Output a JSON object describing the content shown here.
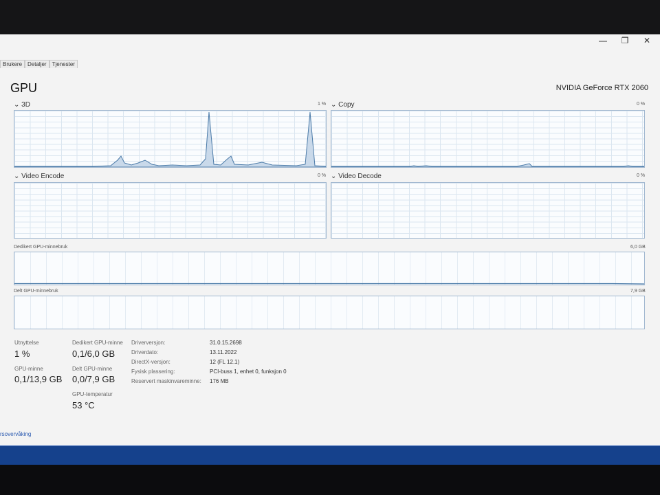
{
  "window": {
    "maximize_glyph": "❐",
    "close_glyph": "✕",
    "minimize_glyph": "—"
  },
  "tabs": [
    "Brukere",
    "Detaljer",
    "Tjenester"
  ],
  "gpu": {
    "title": "GPU",
    "name": "NVIDIA GeForce RTX 2060"
  },
  "engines": [
    {
      "label": "3D",
      "percent": "1 %"
    },
    {
      "label": "Copy",
      "percent": "0 %"
    },
    {
      "label": "Video Encode",
      "percent": "0 %"
    },
    {
      "label": "Video Decode",
      "percent": "0 %"
    }
  ],
  "memory": {
    "dedicated_label": "Dedikert GPU-minnebruk",
    "dedicated_max": "6,0 GB",
    "shared_label": "Delt GPU-minnebruk",
    "shared_max": "7,9 GB"
  },
  "stats": {
    "utilization_label": "Utnyttelse",
    "utilization_value": "1 %",
    "gpu_memory_label": "GPU-minne",
    "gpu_memory_value": "0,1/13,9 GB",
    "dedicated_label": "Dedikert GPU-minne",
    "dedicated_value": "0,1/6,0 GB",
    "shared_label": "Delt GPU-minne",
    "shared_value": "0,0/7,9 GB",
    "temp_label": "GPU-temperatur",
    "temp_value": "53 °C"
  },
  "info": [
    {
      "key": "Driverversjon:",
      "value": "31.0.15.2698"
    },
    {
      "key": "Driverdato:",
      "value": "13.11.2022"
    },
    {
      "key": "DirectX-versjon:",
      "value": "12 (FL 12.1)"
    },
    {
      "key": "Fysisk plassering:",
      "value": "PCI-buss 1, enhet 0, funksjon 0"
    },
    {
      "key": "Reservert maskinvareminne:",
      "value": "176 MB"
    }
  ],
  "footer_link": "rsovervåking",
  "colors": {
    "graph_line": "#4a7aa8",
    "graph_fill": "#c9d9ea",
    "taskbar": "#15418c"
  }
}
